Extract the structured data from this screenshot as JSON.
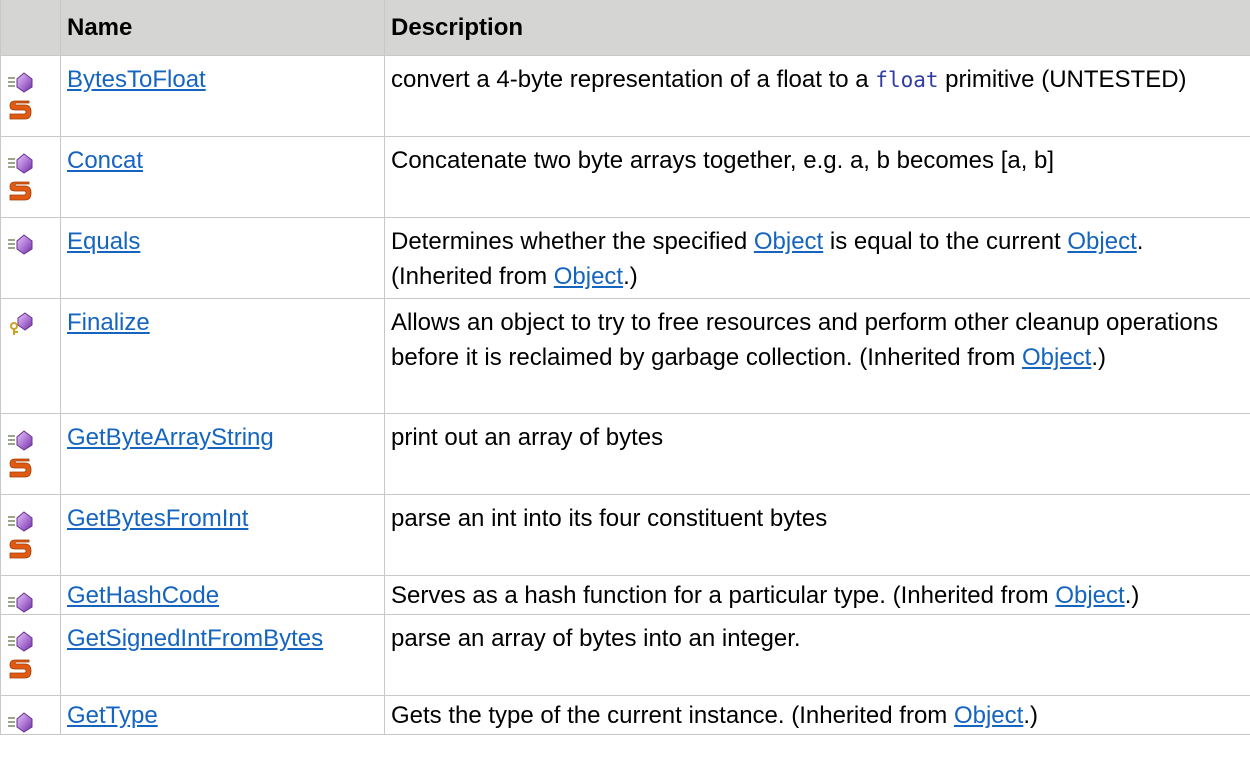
{
  "table": {
    "headers": {
      "icon": "",
      "name": "Name",
      "description": "Description"
    },
    "link_color": "#1565c0",
    "header_bg": "#d5d5d3",
    "rows": [
      {
        "name": "BytesToFloat",
        "icons": [
          "public-method-icon",
          "static-icon"
        ],
        "desc": {
          "pre": "convert a 4-byte representation of a float to a ",
          "code": "float",
          "post": " primitive (UNTESTED)"
        }
      },
      {
        "name": "Concat",
        "icons": [
          "public-method-icon",
          "static-icon"
        ],
        "desc": {
          "text": "Concatenate two byte arrays together, e.g. a, b becomes [a, b]"
        }
      },
      {
        "name": "Equals",
        "icons": [
          "public-method-icon"
        ],
        "desc": {
          "p1": "Determines whether the specified ",
          "link1": "Object",
          "p2": " is equal to the current ",
          "link2": "Object",
          "p3": ". (Inherited from ",
          "link3": "Object",
          "p4": ".)"
        }
      },
      {
        "name": "Finalize",
        "icons": [
          "protected-method-icon"
        ],
        "desc": {
          "p1": "Allows an object to try to free resources and perform other cleanup operations before it is reclaimed by garbage collection. (Inherited from ",
          "link1": "Object",
          "p2": ".)"
        }
      },
      {
        "name": "GetByteArrayString",
        "icons": [
          "public-method-icon",
          "static-icon"
        ],
        "desc": {
          "text": "print out an array of bytes"
        }
      },
      {
        "name": "GetBytesFromInt",
        "icons": [
          "public-method-icon",
          "static-icon"
        ],
        "desc": {
          "text": "parse an int into its four constituent bytes"
        }
      },
      {
        "name": "GetHashCode",
        "icons": [
          "public-method-icon"
        ],
        "desc": {
          "p1": "Serves as a hash function for a particular type. (Inherited from ",
          "link1": "Object",
          "p2": ".)"
        }
      },
      {
        "name": "GetSignedIntFromBytes",
        "icons": [
          "public-method-icon",
          "static-icon"
        ],
        "desc": {
          "text": "parse an array of bytes into an integer."
        }
      },
      {
        "name": "GetType",
        "icons": [
          "public-method-icon"
        ],
        "desc": {
          "p1": "Gets the type of the current instance. (Inherited from ",
          "link1": "Object",
          "p2": ".)"
        }
      }
    ]
  }
}
